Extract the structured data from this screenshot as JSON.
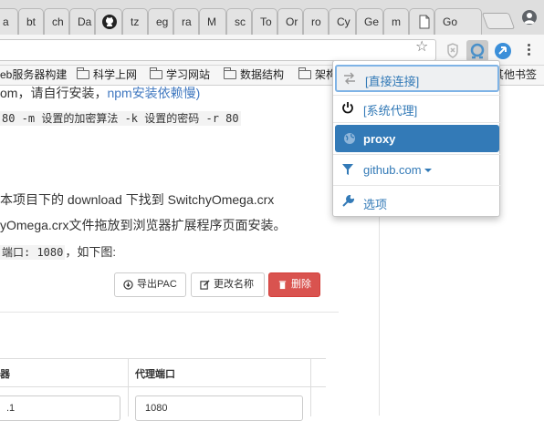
{
  "browser": {
    "tabs": [
      {
        "label": "a",
        "icon": ""
      },
      {
        "label": "bt",
        "icon": ""
      },
      {
        "label": "ch",
        "icon": ""
      },
      {
        "label": "Da",
        "icon": ""
      },
      {
        "label": "",
        "icon": "github-icon"
      },
      {
        "label": "tz",
        "icon": ""
      },
      {
        "label": "eg",
        "icon": ""
      },
      {
        "label": "ra",
        "icon": ""
      },
      {
        "label": "M",
        "icon": ""
      },
      {
        "label": "sc",
        "icon": ""
      },
      {
        "label": "To",
        "icon": ""
      },
      {
        "label": "Or",
        "icon": ""
      },
      {
        "label": "ro",
        "icon": ""
      },
      {
        "label": "Cy",
        "icon": ""
      },
      {
        "label": "Ge",
        "icon": ""
      },
      {
        "label": "m",
        "icon": ""
      },
      {
        "label": "",
        "icon": "document-icon"
      },
      {
        "label": "Go",
        "icon": ""
      }
    ],
    "bookmarks": [
      {
        "label": "eb服务器构建",
        "folder": false
      },
      {
        "label": "科学上网",
        "folder": true
      },
      {
        "label": "学习网站",
        "folder": true
      },
      {
        "label": "数据结构",
        "folder": true
      },
      {
        "label": "架构",
        "folder": true
      },
      {
        "label": "其他书签",
        "folder": false
      }
    ]
  },
  "page": {
    "line1_prefix": "om，请自行安装，",
    "line1_link": "npm安装依赖慢)",
    "line2_code": "80 -m 设置的加密算法 -k 设置的密码 -r 80",
    "line3": "本项目下的 download 下找到 SwitchyOmega.crx",
    "line4": "yOmega.crx文件拖放到浏览器扩展程序页面安装。",
    "line5_code": "端口: 1080",
    "line5_suffix": "，如下图:",
    "buttons": {
      "export_pac": "导出PAC",
      "rename": "更改名称",
      "delete": "删除"
    },
    "table": {
      "col1_header": "器",
      "col2_header": "代理端口",
      "col1_value": ".1",
      "col2_value": "1080"
    }
  },
  "popup": {
    "items": [
      {
        "label": "[直接连接]",
        "icon": "direct-arrows-icon",
        "selected": true
      },
      {
        "label": "[系统代理]",
        "icon": "power-icon"
      },
      {
        "label": "proxy",
        "icon": "globe-icon",
        "active": true
      },
      {
        "label": "github.com",
        "icon": "filter-icon"
      },
      {
        "label": "选项",
        "icon": "wrench-icon"
      }
    ],
    "active_color": "#337ab7"
  }
}
